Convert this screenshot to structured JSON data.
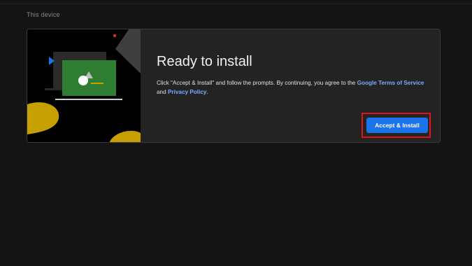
{
  "section": {
    "label": "This device"
  },
  "card": {
    "title": "Ready to install",
    "description_prefix": "Click \"Accept & Install\" and follow the prompts. By continuing, you agree to the ",
    "terms_link": "Google Terms of Service",
    "description_middle": "and ",
    "privacy_link": "Privacy Policy",
    "description_suffix": ".",
    "accept_button": "Accept & Install"
  },
  "colors": {
    "accent": "#1a73e8",
    "link": "#7aa9ff",
    "highlight": "#e3141b",
    "illustration_green": "#2e7d32",
    "illustration_yellow": "#c5a000"
  },
  "icons": [
    "laptop-illustration-icon",
    "play-arrow-icon",
    "shapes-icon"
  ]
}
